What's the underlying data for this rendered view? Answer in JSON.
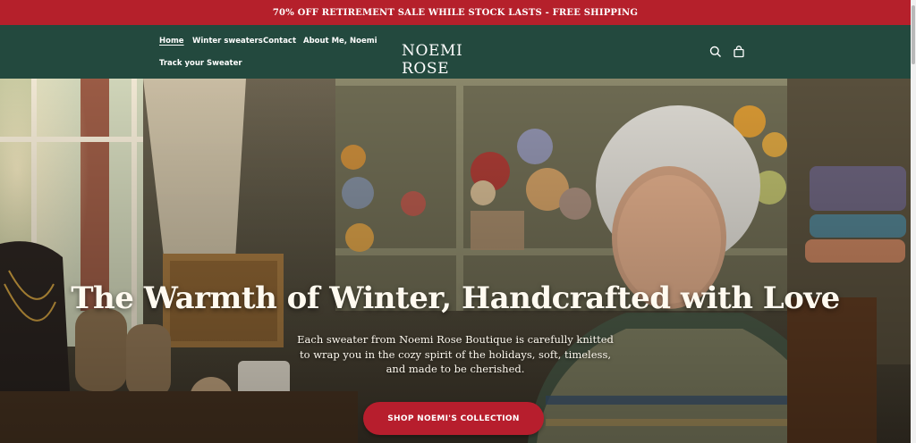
{
  "announcement": {
    "text": "70% OFF RETIREMENT SALE WHILE STOCK LASTS - FREE SHIPPING"
  },
  "header": {
    "brand": "NOEMI ROSE",
    "nav": [
      {
        "label": "Home",
        "active": true
      },
      {
        "label": "Winter sweaters",
        "active": false
      },
      {
        "label": "Contact",
        "active": false
      },
      {
        "label": "About Me, Noemi",
        "active": false
      },
      {
        "label": "Track your Sweater",
        "active": false
      }
    ],
    "icons": [
      "search-icon",
      "cart-icon"
    ]
  },
  "hero": {
    "title": "The Warmth of Winter, Handcrafted with Love",
    "subtitle": "Each sweater from Noemi Rose Boutique is carefully knitted to wrap you in the cozy spirit of the holidays, soft, timeless, and made to be cherished.",
    "cta": "SHOP NOEMI'S COLLECTION",
    "image": "elderly woman knitting in a cozy yarn shop"
  },
  "colors": {
    "announcement_bg": "#b5202b",
    "header_bg": "#23493e",
    "cta_bg": "#b71e2d",
    "text_light": "#fffaf0"
  }
}
